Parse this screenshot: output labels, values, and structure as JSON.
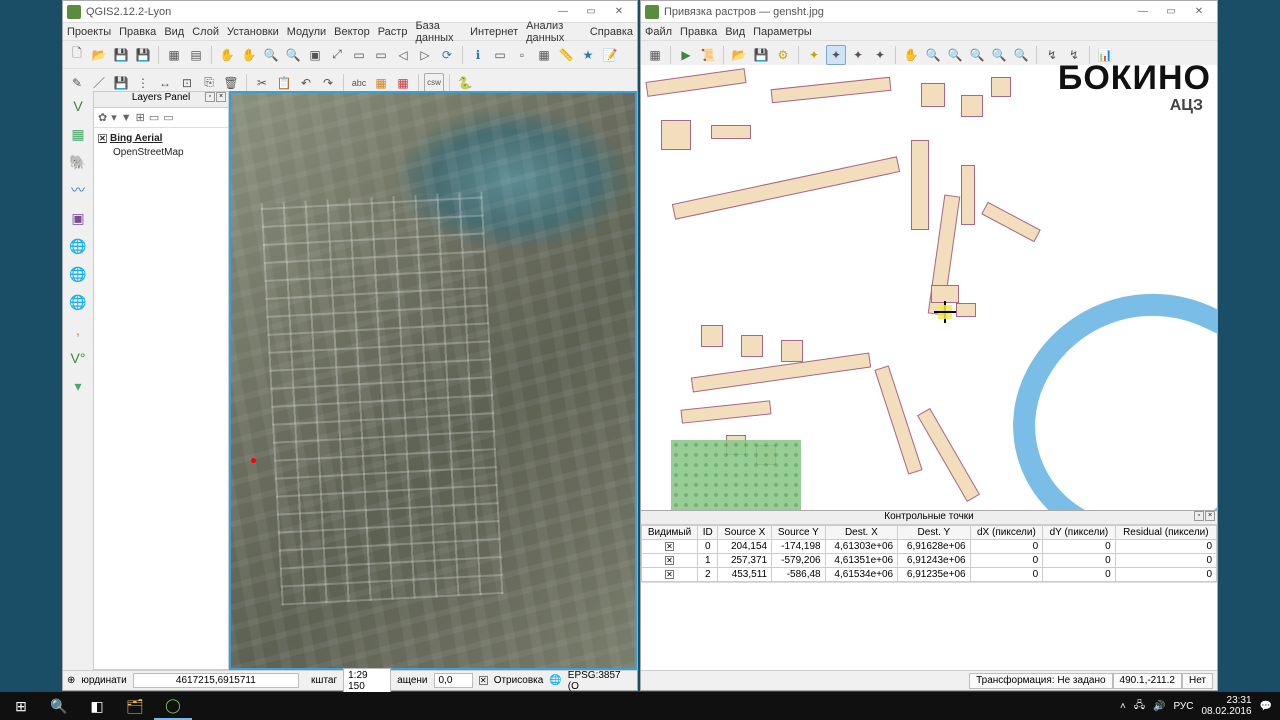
{
  "left": {
    "title": "QGIS2.12.2-Lyon",
    "menus": [
      "Проекты",
      "Правка",
      "Вид",
      "Слой",
      "Установки",
      "Модули",
      "Вектор",
      "Растр",
      "База данных",
      "Интернет",
      "Анализ данных",
      "Справка"
    ],
    "layers_panel_title": "Layers Panel",
    "layers": [
      {
        "name": "Bing Aerial",
        "checked": true,
        "selected": true
      },
      {
        "name": "OpenStreetMap",
        "checked": false,
        "selected": false
      }
    ],
    "status": {
      "coord_label": "юрдинати",
      "coord_value": "4617215,6915711",
      "scale_label": "кштаг",
      "scale_value": "1:29 150",
      "rotation_label": "ащени",
      "rotation_value": "0,0",
      "render_label": "Отрисовка",
      "crs": "EPSG:3857 (O"
    }
  },
  "right": {
    "title": "Привязка растров — gensht.jpg",
    "menus": [
      "Файл",
      "Правка",
      "Вид",
      "Параметры"
    ],
    "map_title": "БОКИНО",
    "map_subtitle": "АЦЗ",
    "gcp_title": "Контрольные точки",
    "gcp_headers": [
      "Видимый",
      "ID",
      "Source X",
      "Source Y",
      "Dest. X",
      "Dest. Y",
      "dX (пиксели)",
      "dY (пиксели)",
      "Residual (пиксели)"
    ],
    "gcp_rows": [
      {
        "vis": true,
        "id": "0",
        "sx": "204,154",
        "sy": "-174,198",
        "dx": "4,61303e+06",
        "dy": "6,91628e+06",
        "rx": "0",
        "ry": "0",
        "res": "0"
      },
      {
        "vis": true,
        "id": "1",
        "sx": "257,371",
        "sy": "-579,206",
        "dx": "4,61351e+06",
        "dy": "6,91243e+06",
        "rx": "0",
        "ry": "0",
        "res": "0"
      },
      {
        "vis": true,
        "id": "2",
        "sx": "453,511",
        "sy": "-586,48",
        "dx": "4,61534e+06",
        "dy": "6,91235e+06",
        "rx": "0",
        "ry": "0",
        "res": "0"
      }
    ],
    "status": {
      "transform": "Трансформация: Не задано",
      "coords": "490.1,-211.2",
      "last": "Нет"
    }
  },
  "taskbar": {
    "time": "23:31",
    "date": "08.02.2016",
    "lang": "РУС"
  }
}
